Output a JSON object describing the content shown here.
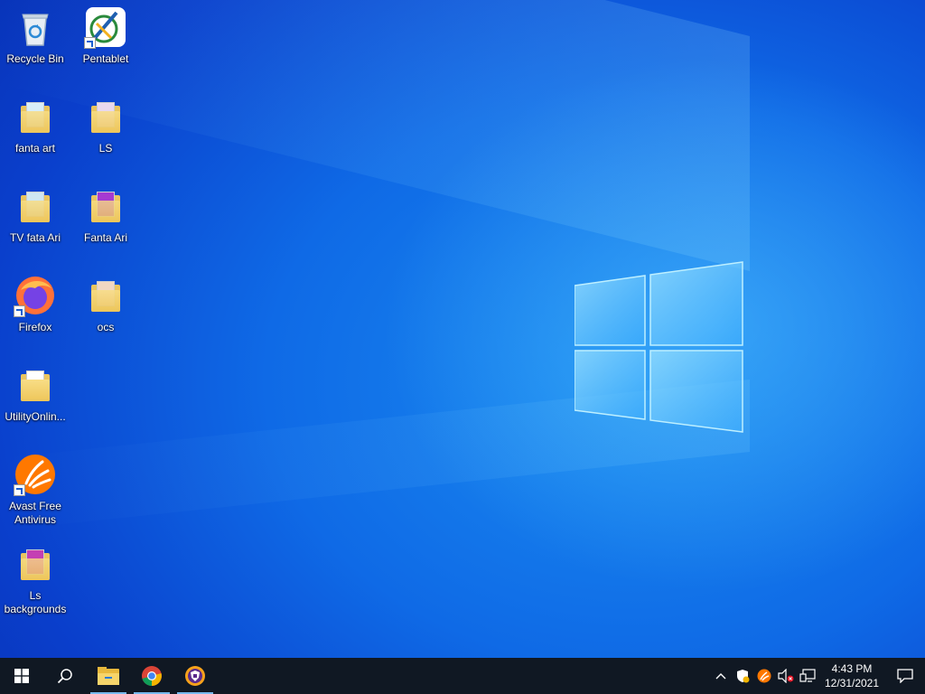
{
  "desktop": {
    "icons": [
      {
        "label": "Recycle Bin",
        "icon": "recycle-bin-icon"
      },
      {
        "label": "Pentablet",
        "icon": "pentablet-icon"
      },
      {
        "label": "fanta art",
        "icon": "folder-icon"
      },
      {
        "label": "LS",
        "icon": "folder-icon"
      },
      {
        "label": "TV  fata Ari",
        "icon": "folder-icon"
      },
      {
        "label": "Fanta Ari",
        "icon": "folder-icon"
      },
      {
        "label": "Firefox",
        "icon": "firefox-icon"
      },
      {
        "label": "ocs",
        "icon": "folder-icon"
      },
      {
        "label": "UtilityOnlin...",
        "icon": "folder-icon"
      },
      {
        "label": "Avast Free Antivirus",
        "icon": "avast-icon"
      },
      {
        "label": "Ls backgrounds",
        "icon": "folder-icon"
      }
    ]
  },
  "taskbar": {
    "start": "windows-start-icon",
    "search": "search-icon",
    "pinned": [
      {
        "name": "file-explorer-icon",
        "active": true
      },
      {
        "name": "chrome-icon",
        "active": true
      },
      {
        "name": "avast-secure-browser-icon",
        "active": true
      }
    ],
    "tray": [
      "chevron-up-icon",
      "defender-icon",
      "avast-tray-icon",
      "volume-muted-icon",
      "network-icon"
    ],
    "time": "4:43 PM",
    "date": "12/31/2021",
    "notifications": "action-center-icon"
  },
  "colors": {
    "taskbar": "#101823",
    "wallpaper": "#0f6ae6",
    "accent": "#76b9ed"
  }
}
